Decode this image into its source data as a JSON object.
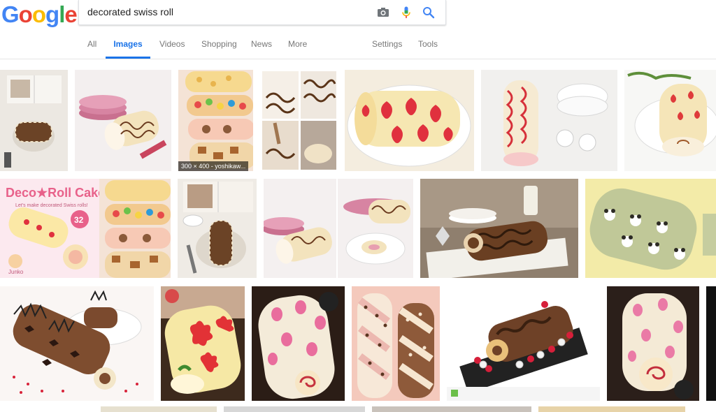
{
  "logo": "Google",
  "search": {
    "query": "decorated swiss roll"
  },
  "tabs": {
    "all": "All",
    "images": "Images",
    "videos": "Videos",
    "shopping": "Shopping",
    "news": "News",
    "more": "More",
    "settings": "Settings",
    "tools": "Tools"
  },
  "results": {
    "caption_r1_3": "300 × 400 - yoshikaw...",
    "book_title": "Deco★Roll Cakes",
    "book_subtitle": "Let's make decorated Swiss rolls!",
    "book_badge_num": "32",
    "book_author": "Junko"
  },
  "colors": {
    "google_blue": "#4285F4",
    "google_red": "#EA4335",
    "google_yellow": "#FBBC05",
    "google_green": "#34A853",
    "active_tab": "#1a73e8"
  }
}
